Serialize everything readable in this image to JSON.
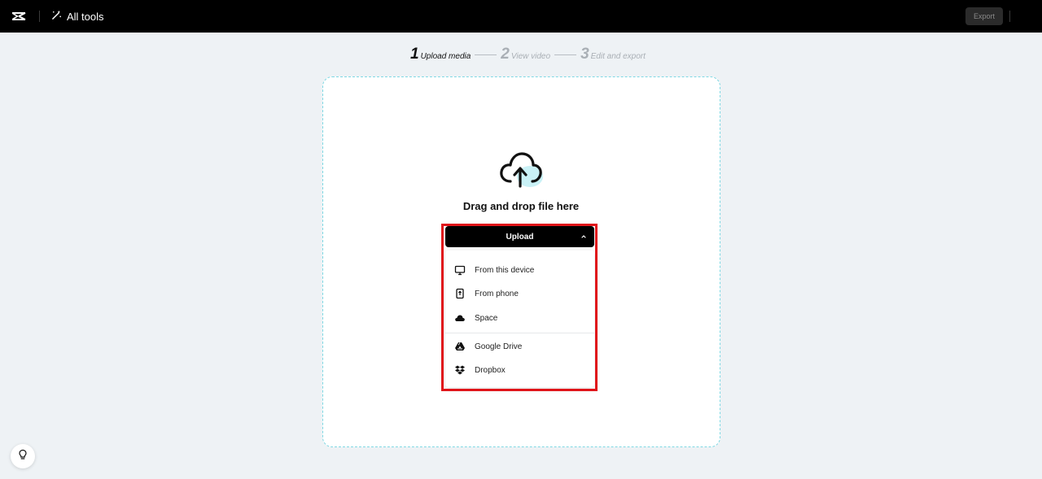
{
  "topbar": {
    "logo_icon": "capcut-logo-icon",
    "all_tools_label": "All tools",
    "all_tools_icon": "magic-wand-icon",
    "export_label": "Export"
  },
  "steps": [
    {
      "num": "1",
      "label": "Upload media",
      "active": true
    },
    {
      "num": "2",
      "label": "View video",
      "active": false
    },
    {
      "num": "3",
      "label": "Edit and export",
      "active": false
    }
  ],
  "dropzone": {
    "icon": "cloud-upload-icon",
    "drag_text": "Drag and drop file here",
    "upload_label": "Upload"
  },
  "upload_menu": {
    "items": [
      {
        "label": "From this device",
        "icon": "monitor-icon"
      },
      {
        "label": "From phone",
        "icon": "phone-upload-icon"
      },
      {
        "label": "Space",
        "icon": "cloud-icon"
      },
      {
        "label": "Google Drive",
        "icon": "google-drive-icon"
      },
      {
        "label": "Dropbox",
        "icon": "dropbox-icon"
      }
    ]
  },
  "help": {
    "icon": "lightbulb-icon"
  },
  "colors": {
    "topbar": "#000000",
    "page_bg": "#eef2f5",
    "dropzone_border": "#7fd8e3",
    "highlight": "#e0141a"
  }
}
